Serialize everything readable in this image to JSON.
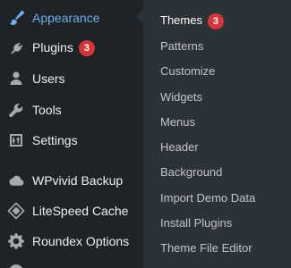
{
  "sidebar": {
    "items": [
      {
        "label": "Appearance",
        "icon": "paintbrush-icon"
      },
      {
        "label": "Plugins",
        "badge": "3",
        "icon": "plug-icon"
      },
      {
        "label": "Users",
        "icon": "user-icon"
      },
      {
        "label": "Tools",
        "icon": "wrench-icon"
      },
      {
        "label": "Settings",
        "icon": "sliders-icon"
      },
      {
        "label": "WPvivid Backup",
        "icon": "cloud-icon"
      },
      {
        "label": "LiteSpeed Cache",
        "icon": "diamond-icon"
      },
      {
        "label": "Roundex Options",
        "icon": "gear-icon"
      }
    ]
  },
  "submenu": {
    "items": [
      {
        "label": "Themes",
        "badge": "3"
      },
      {
        "label": "Patterns"
      },
      {
        "label": "Customize"
      },
      {
        "label": "Widgets"
      },
      {
        "label": "Menus"
      },
      {
        "label": "Header"
      },
      {
        "label": "Background"
      },
      {
        "label": "Import Demo Data"
      },
      {
        "label": "Install Plugins"
      },
      {
        "label": "Theme File Editor"
      }
    ]
  },
  "colors": {
    "sidebar_bg": "#1d2327",
    "submenu_bg": "#2c3338",
    "accent": "#72aee6",
    "badge": "#d63638"
  }
}
